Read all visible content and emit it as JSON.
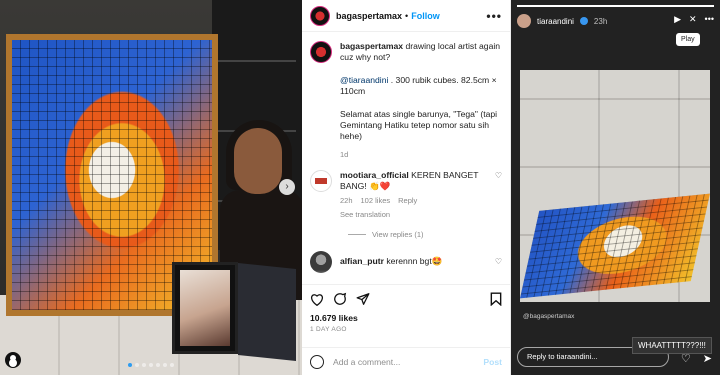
{
  "post": {
    "username": "bagaspertamax",
    "separator": "•",
    "follow_label": "Follow",
    "more_label": "•••",
    "caption_lines": [
      "drawing local artist again cuz why not?",
      "@tiaraandini . 300 rubik cubes. 82.5cm × 110cm",
      "Selamat atas single barunya, \"Tega\" (tapi Gemintang Hatiku tetep nomor satu sih hehe)"
    ],
    "caption_mention": "@tiaraandini",
    "caption_rest": ". 300 rubik cubes. 82.5cm × 110cm",
    "caption_line1": "drawing local artist again cuz why not?",
    "caption_line3": "Selamat atas single barunya, \"Tega\" (tapi Gemintang Hatiku tetep nomor satu sih hehe)",
    "caption_time": "1d",
    "comments": [
      {
        "user": "mootiara_official",
        "text": "KEREN BANGET BANG! 👏❤️",
        "time": "22h",
        "likes": "102 likes",
        "reply": "Reply",
        "translation": "See translation",
        "view_replies": "View replies (1)"
      },
      {
        "user": "alfian_putr",
        "text": "kerennn bgt🤩"
      }
    ],
    "likes": "10.679 likes",
    "date": "1 DAY AGO",
    "add_comment_placeholder": "Add a comment...",
    "post_label": "Post"
  },
  "story": {
    "username": "tiaraandini",
    "time": "23h",
    "tooltip": "Play",
    "watermark": "@bagaspertamax",
    "overlay_text": "WHAATTTTT???!!!",
    "reply_placeholder": "Reply to tiaraandini..."
  },
  "colors": {
    "accent_blue": "#0095f6",
    "mention_blue": "#00376b"
  }
}
